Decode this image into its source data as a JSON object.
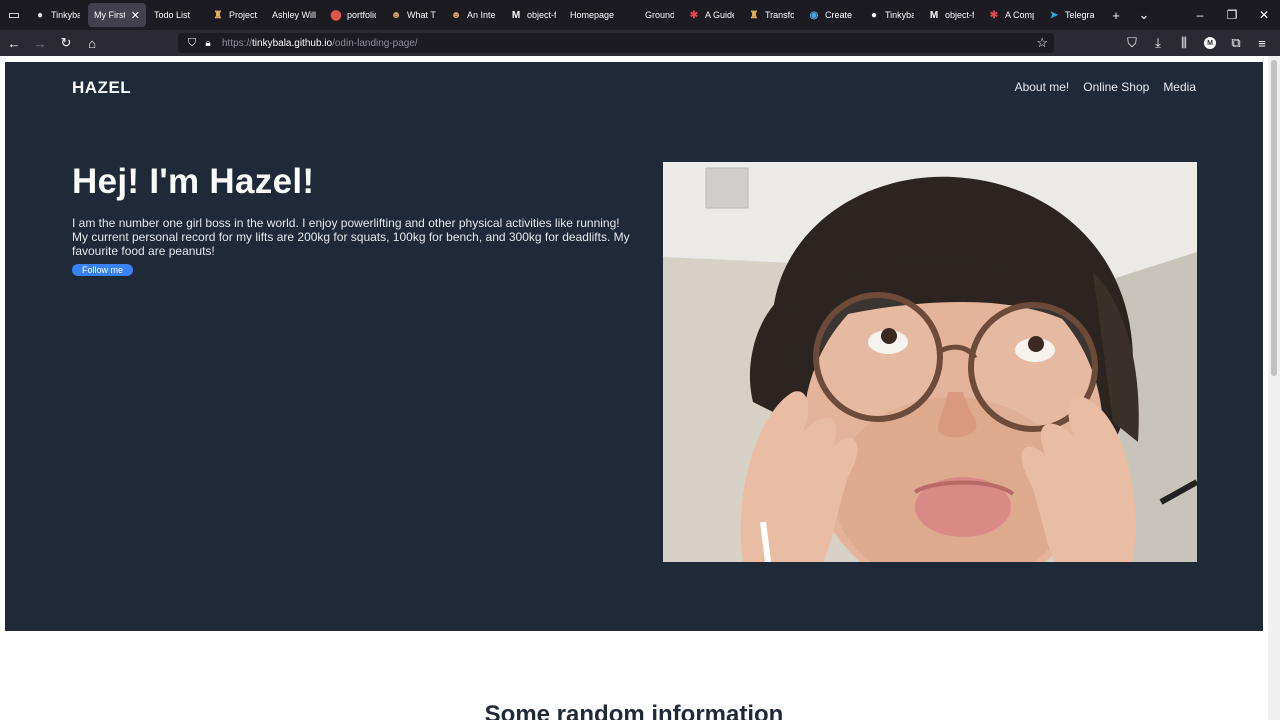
{
  "browser": {
    "tabs": [
      {
        "label": "Tinkybala",
        "icon": "github-icon",
        "color": "#fbfbfe",
        "active": false
      },
      {
        "label": "My First L",
        "icon": "none",
        "color": "",
        "active": true
      },
      {
        "label": "Todo List",
        "icon": "none",
        "color": "",
        "active": false
      },
      {
        "label": "Project: L",
        "icon": "odin-icon",
        "color": "#e0b050",
        "active": false
      },
      {
        "label": "Ashley Willi",
        "icon": "none",
        "color": "",
        "active": false
      },
      {
        "label": "portfolio",
        "icon": "portfolio-icon",
        "color": "#e0554a",
        "active": false
      },
      {
        "label": "What Thi",
        "icon": "avatar-icon",
        "color": "#d9a066",
        "active": false
      },
      {
        "label": "An Intera",
        "icon": "avatar-icon",
        "color": "#d9a066",
        "active": false
      },
      {
        "label": "object-fit",
        "icon": "medium-icon",
        "color": "#fbfbfe",
        "active": false
      },
      {
        "label": "Homepage",
        "icon": "none",
        "color": "",
        "active": false
      },
      {
        "label": "Grounde",
        "icon": "box-icon",
        "color": "#1c1b22",
        "active": false
      },
      {
        "label": "A Guide",
        "icon": "asterisk-icon",
        "color": "#e04a4a",
        "active": false
      },
      {
        "label": "Transfor",
        "icon": "odin-icon",
        "color": "#e0b050",
        "active": false
      },
      {
        "label": "Create a",
        "icon": "circle-icon",
        "color": "#4aa3e0",
        "active": false
      },
      {
        "label": "Tinkybal",
        "icon": "github-icon",
        "color": "#fbfbfe",
        "active": false
      },
      {
        "label": "object-fit",
        "icon": "medium-icon",
        "color": "#fbfbfe",
        "active": false
      },
      {
        "label": "A Compl",
        "icon": "asterisk-icon",
        "color": "#e04a4a",
        "active": false
      },
      {
        "label": "Telegram",
        "icon": "telegram-icon",
        "color": "#2ea6e0",
        "active": false
      }
    ],
    "active_tab_close": "✕",
    "url_prefix": "https://",
    "url_domain": "tinkybala.github.io",
    "url_path": "/odin-landing-page/"
  },
  "site": {
    "logo": "HAZEL",
    "nav": [
      "About me!",
      "Online Shop",
      "Media"
    ],
    "hero_title": "Hej! I'm Hazel!",
    "hero_text": "I am the number one girl boss in the world. I enjoy powerlifting and other physical activities like running! My current personal record for my lifts are 200kg for squats, 100kg for bench, and 300kg for deadlifts. My favourite food are peanuts!",
    "follow_button": "Follow me",
    "section_heading": "Some random information",
    "colors": {
      "hero_bg": "#1f2937",
      "accent": "#3882f6",
      "text_light": "#f9faf8",
      "text_muted": "#e5e7eb"
    }
  }
}
